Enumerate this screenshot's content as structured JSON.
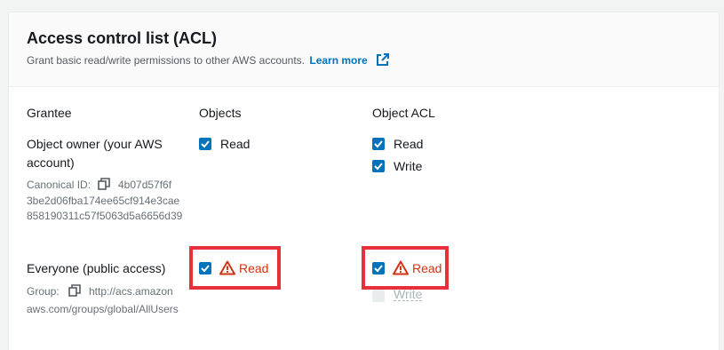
{
  "header": {
    "title": "Access control list (ACL)",
    "description": "Grant basic read/write permissions to other AWS accounts.",
    "learn_more": "Learn more"
  },
  "columns": {
    "grantee": "Grantee",
    "objects": "Objects",
    "object_acl": "Object ACL"
  },
  "owner": {
    "name": "Object owner (your AWS account)",
    "id_label": "Canonical ID:",
    "id_first": "4b07d57f6f",
    "id_rest": "3be2d06fba174ee65cf914e3cae858190311c57f5063d5a6656d39",
    "objects": {
      "read": "Read"
    },
    "acl": {
      "read": "Read",
      "write": "Write"
    }
  },
  "everyone": {
    "name": "Everyone (public access)",
    "group_label": "Group:",
    "group_first": "http://acs.amazon",
    "group_rest": "aws.com/groups/global/AllUsers",
    "objects": {
      "read": "Read"
    },
    "acl": {
      "read": "Read",
      "write": "Write"
    }
  },
  "colors": {
    "accent": "#0073bb",
    "warning": "#d13212",
    "highlight": "#e8303c"
  }
}
